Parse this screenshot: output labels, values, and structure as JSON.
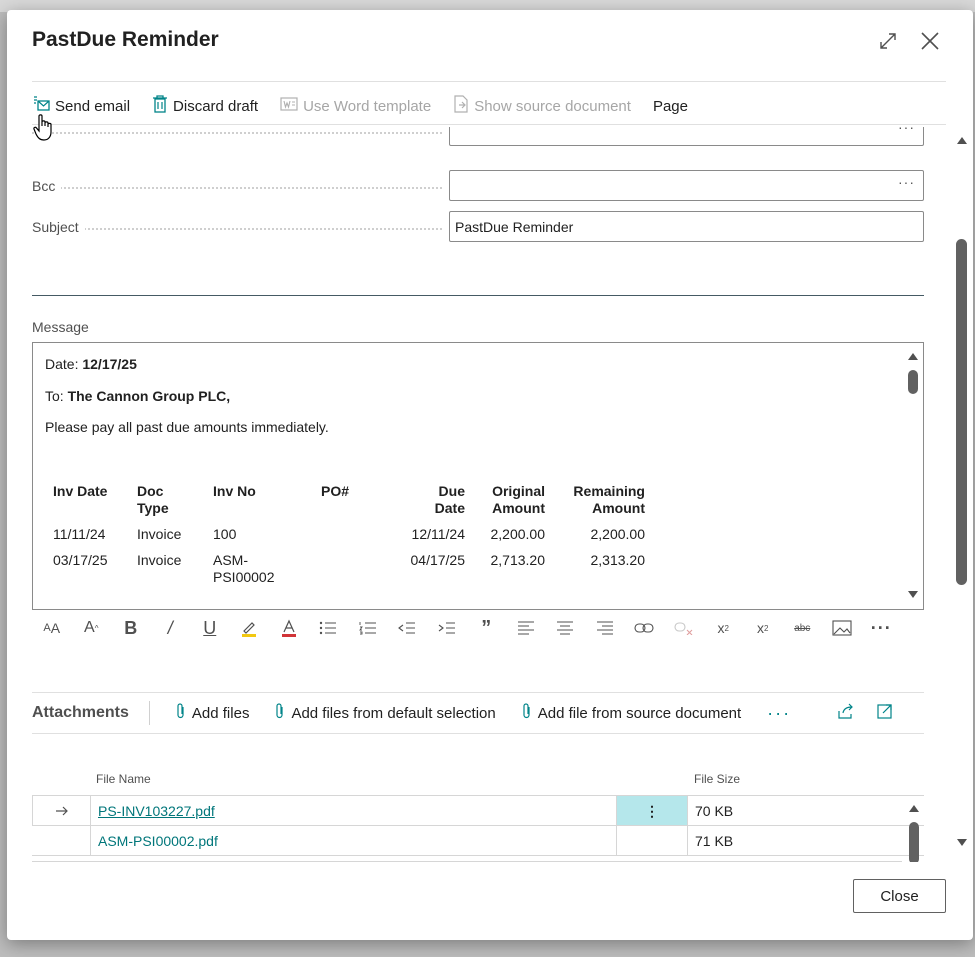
{
  "dialog": {
    "title": "PastDue Reminder",
    "expand_icon": "expand-icon",
    "close_icon": "close-icon"
  },
  "actions": {
    "send_email": "Send email",
    "discard_draft": "Discard draft",
    "use_word_template": "Use Word template",
    "show_source_document": "Show source document",
    "page": "Page"
  },
  "fields": {
    "bcc_label": "Bcc",
    "bcc_value": "",
    "subject_label": "Subject",
    "subject_value": "PastDue Reminder",
    "ellipsis": "···"
  },
  "message": {
    "label": "Message",
    "date_prefix": "Date:",
    "date_value": "12/17/25",
    "to_prefix": "To:",
    "to_value": "The Cannon Group PLC,",
    "body": "Please pay all past due amounts immediately.",
    "table": {
      "headers": {
        "inv_date": "Inv Date",
        "doc_type_1": "Doc",
        "doc_type_2": "Type",
        "inv_no": "Inv No",
        "po": "PO#",
        "due_date_1": "Due",
        "due_date_2": "Date",
        "orig_1": "Original",
        "orig_2": "Amount",
        "rem_1": "Remaining",
        "rem_2": "Amount"
      },
      "rows": [
        {
          "inv_date": "11/11/24",
          "doc_type": "Invoice",
          "inv_no_1": "100",
          "inv_no_2": "",
          "po": "",
          "due_date": "12/11/24",
          "original": "2,200.00",
          "remaining": "2,200.00"
        },
        {
          "inv_date": "03/17/25",
          "doc_type": "Invoice",
          "inv_no_1": "ASM-",
          "inv_no_2": "PSI00002",
          "po": "",
          "due_date": "04/17/25",
          "original": "2,713.20",
          "remaining": "2,313.20"
        }
      ]
    }
  },
  "attachments": {
    "title": "Attachments",
    "add_files": "Add files",
    "add_default": "Add files from default selection",
    "add_source": "Add file from source document",
    "more": "···",
    "col_file_name": "File Name",
    "col_file_size": "File Size",
    "rows": [
      {
        "name": "PS-INV103227.pdf",
        "size": "70 KB"
      },
      {
        "name": "ASM-PSI00002.pdf",
        "size": "71 KB"
      }
    ]
  },
  "footer": {
    "close_label": "Close"
  },
  "colors": {
    "accent": "#00767a",
    "selected_cell": "#b5e7eb"
  }
}
